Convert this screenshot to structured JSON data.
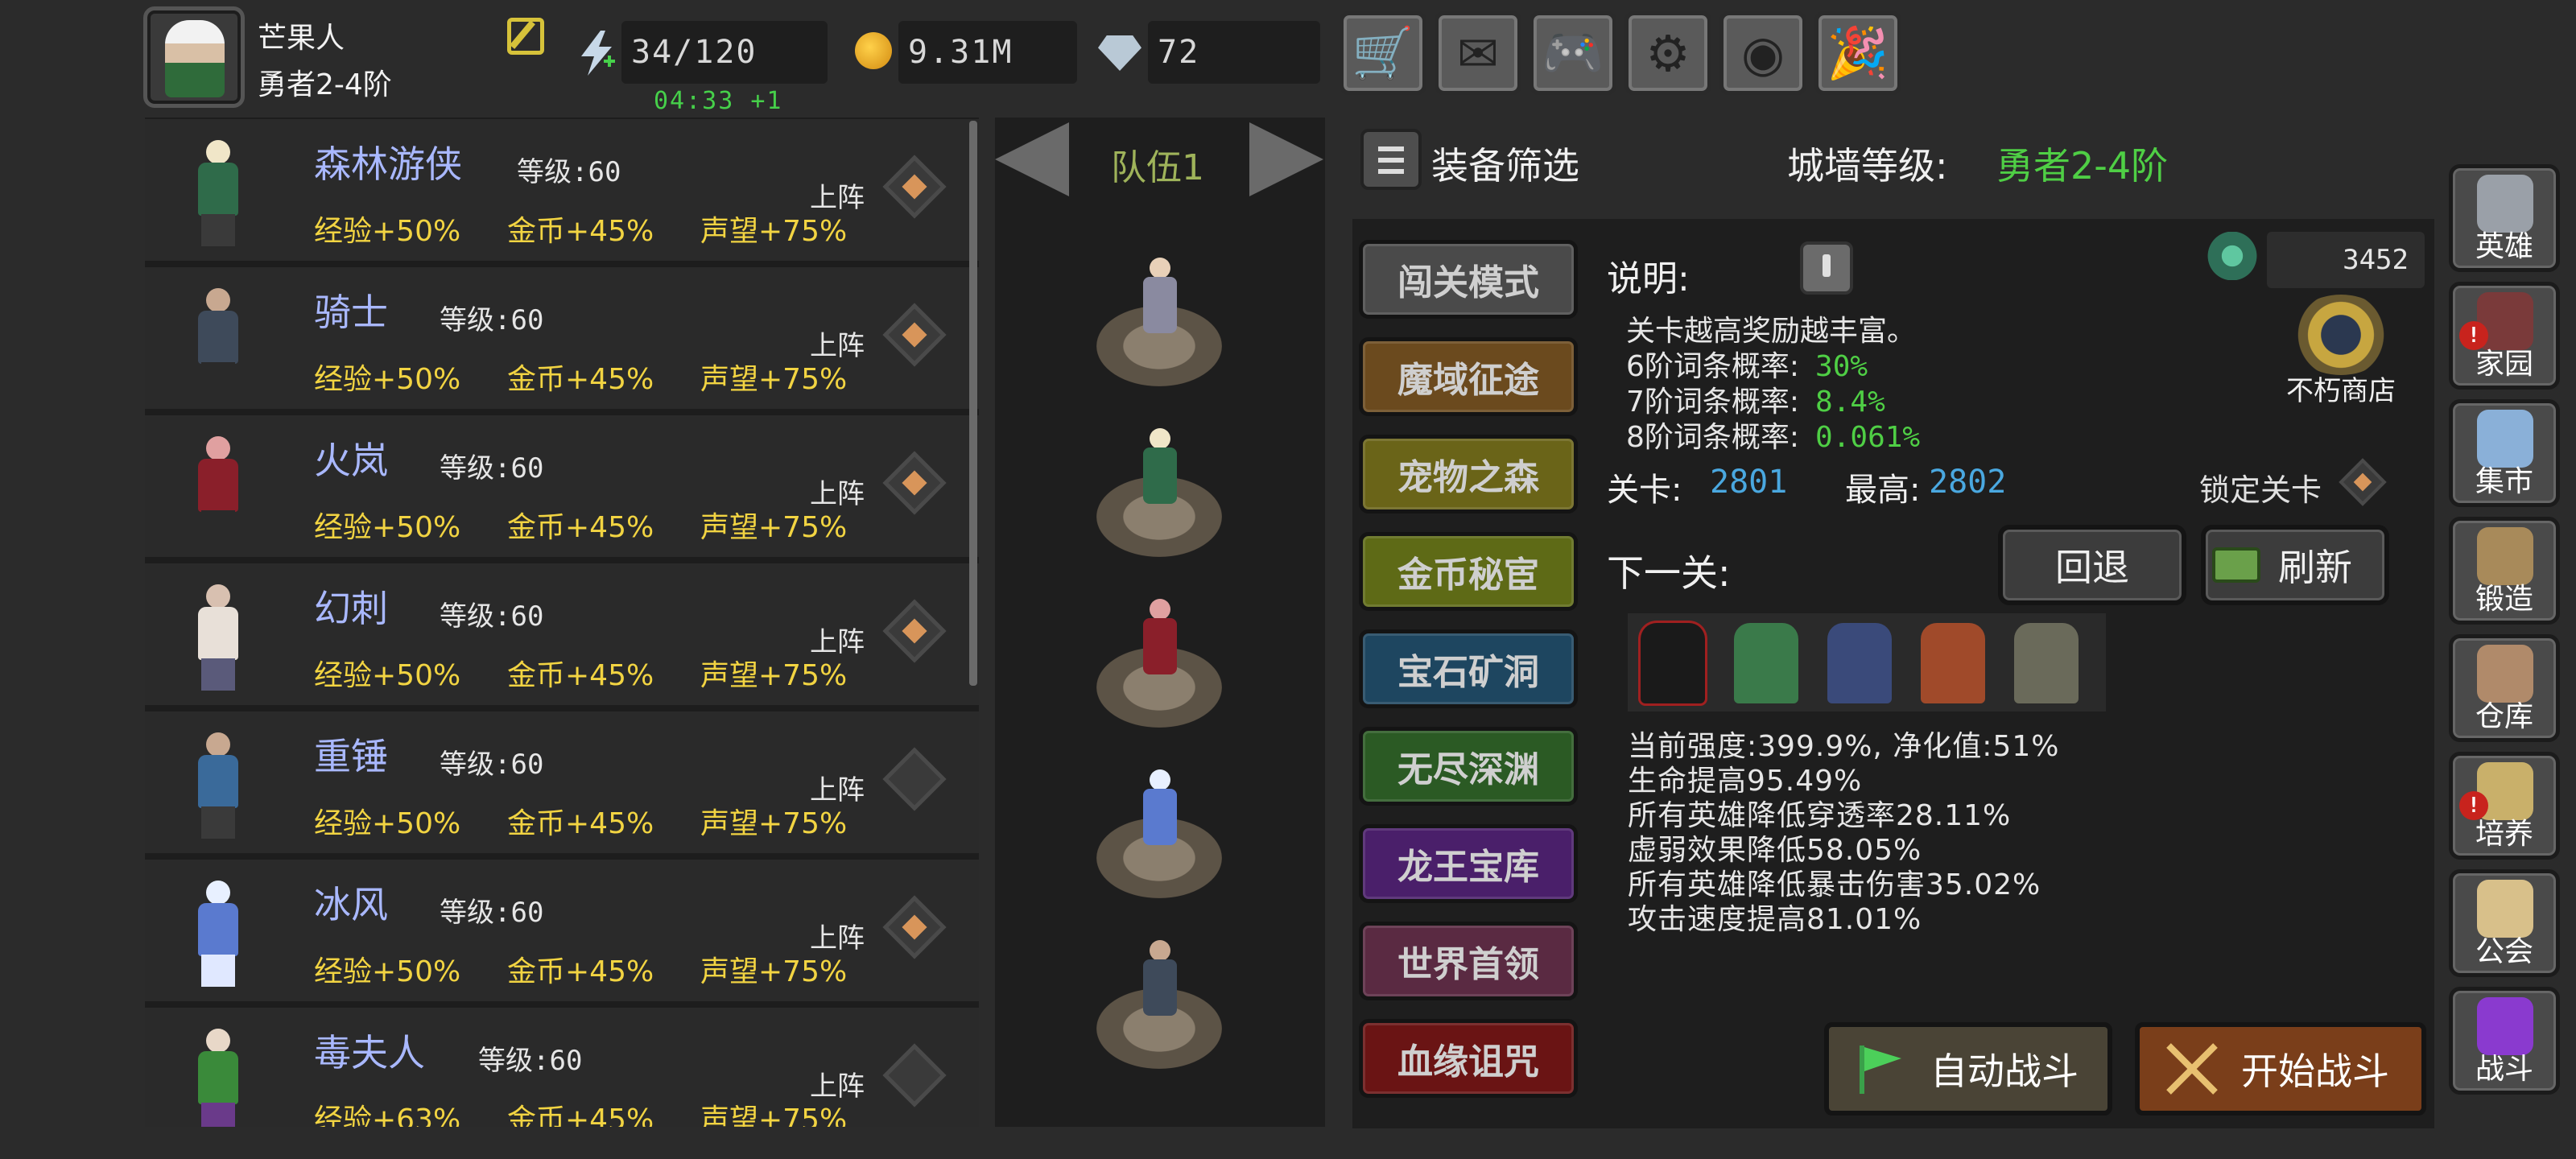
{
  "player": {
    "name": "芒果人",
    "rank": "勇者2-4阶"
  },
  "resources": {
    "energy": "34/120",
    "energy_timer": "04:33 +1",
    "gold": "9.31M",
    "gems": "72"
  },
  "top_buttons": [
    {
      "name": "shop",
      "icon": "cart-icon",
      "glyph": "🛒"
    },
    {
      "name": "mail",
      "icon": "mail-icon",
      "glyph": "✉"
    },
    {
      "name": "gamepad",
      "icon": "gamepad-icon",
      "glyph": "🎮"
    },
    {
      "name": "settings",
      "icon": "gear-icon",
      "glyph": "⚙"
    },
    {
      "name": "color",
      "icon": "color-wheel-icon",
      "glyph": "◉"
    },
    {
      "name": "party",
      "icon": "party-popper-icon",
      "glyph": "🎉"
    }
  ],
  "heroes": [
    {
      "name": "森林游侠",
      "level_label": "等级:",
      "level": "60",
      "bonus_exp": "经验+50%",
      "bonus_gold": "金币+45%",
      "bonus_rep": "声望+75%",
      "deploy": "上阵",
      "deployed": true
    },
    {
      "name": "骑士",
      "level_label": "等级:",
      "level": "60",
      "bonus_exp": "经验+50%",
      "bonus_gold": "金币+45%",
      "bonus_rep": "声望+75%",
      "deploy": "上阵",
      "deployed": true
    },
    {
      "name": "火岚",
      "level_label": "等级:",
      "level": "60",
      "bonus_exp": "经验+50%",
      "bonus_gold": "金币+45%",
      "bonus_rep": "声望+75%",
      "deploy": "上阵",
      "deployed": true
    },
    {
      "name": "幻刺",
      "level_label": "等级:",
      "level": "60",
      "bonus_exp": "经验+50%",
      "bonus_gold": "金币+45%",
      "bonus_rep": "声望+75%",
      "deploy": "上阵",
      "deployed": true
    },
    {
      "name": "重锤",
      "level_label": "等级:",
      "level": "60",
      "bonus_exp": "经验+50%",
      "bonus_gold": "金币+45%",
      "bonus_rep": "声望+75%",
      "deploy": "上阵",
      "deployed": false
    },
    {
      "name": "冰风",
      "level_label": "等级:",
      "level": "60",
      "bonus_exp": "经验+50%",
      "bonus_gold": "金币+45%",
      "bonus_rep": "声望+75%",
      "deploy": "上阵",
      "deployed": true
    },
    {
      "name": "毒夫人",
      "level_label": "等级:",
      "level": "60",
      "bonus_exp": "经验+63%",
      "bonus_gold": "金币+45%",
      "bonus_rep": "声望+75%",
      "deploy": "上阵",
      "deployed": false
    }
  ],
  "team": {
    "label": "队伍1"
  },
  "filter": {
    "label": "装备筛选"
  },
  "wall": {
    "label": "城墙等级:",
    "value": "勇者2-4阶"
  },
  "modes": [
    {
      "label": "闯关模式",
      "color": "#4a4a4a"
    },
    {
      "label": "魔域征途",
      "color": "#6b4a1e"
    },
    {
      "label": "宠物之森",
      "color": "#6a6418"
    },
    {
      "label": "金币秘宦",
      "color": "#5e6a16"
    },
    {
      "label": "宝石矿洞",
      "color": "#1e4660"
    },
    {
      "label": "无尽深渊",
      "color": "#2b5a24"
    },
    {
      "label": "龙王宝库",
      "color": "#4a1f6a"
    },
    {
      "label": "世界首领",
      "color": "#5a2a42"
    },
    {
      "label": "血缘诅咒",
      "color": "#6a1414"
    }
  ],
  "info": {
    "title": "说明:",
    "desc": "关卡越高奖励越丰富。",
    "rates": [
      {
        "label": "6阶词条概率:",
        "value": "30%"
      },
      {
        "label": "7阶词条概率:",
        "value": "8.4%"
      },
      {
        "label": "8阶词条概率:",
        "value": "0.061%"
      }
    ]
  },
  "currency": {
    "value": "3452"
  },
  "immortal_shop": {
    "label": "不朽商店"
  },
  "stage": {
    "label": "关卡:",
    "value": "2801",
    "best_label": "最高:",
    "best_value": "2802",
    "lock_label": "锁定关卡"
  },
  "next": {
    "label": "下一关:",
    "retreat": "回退",
    "refresh": "刷新"
  },
  "stats": [
    "当前强度:399.9%, 净化值:51%",
    "生命提高95.49%",
    "所有英雄降低穿透率28.11%",
    "虚弱效果降低58.05%",
    "所有英雄降低暴击伤害35.02%",
    "攻击速度提高81.01%"
  ],
  "battle": {
    "auto": "自动战斗",
    "start": "开始战斗"
  },
  "sidebar": [
    {
      "label": "英雄",
      "icon": "helmet-icon",
      "color": "#9aa0a8",
      "alert": false
    },
    {
      "label": "家园",
      "icon": "castle-icon",
      "color": "#7a3a3a",
      "alert": true
    },
    {
      "label": "集市",
      "icon": "market-icon",
      "color": "#8ab0d8",
      "alert": false
    },
    {
      "label": "锻造",
      "icon": "anvil-icon",
      "color": "#a88a5a",
      "alert": false
    },
    {
      "label": "仓库",
      "icon": "chest-icon",
      "color": "#b08a6a",
      "alert": false
    },
    {
      "label": "培养",
      "icon": "trophy-icon",
      "color": "#c9b06a",
      "alert": true
    },
    {
      "label": "公会",
      "icon": "lion-icon",
      "color": "#d8c08a",
      "alert": false
    },
    {
      "label": "战斗",
      "icon": "portal-icon",
      "color": "#8a3acf",
      "alert": false
    }
  ]
}
